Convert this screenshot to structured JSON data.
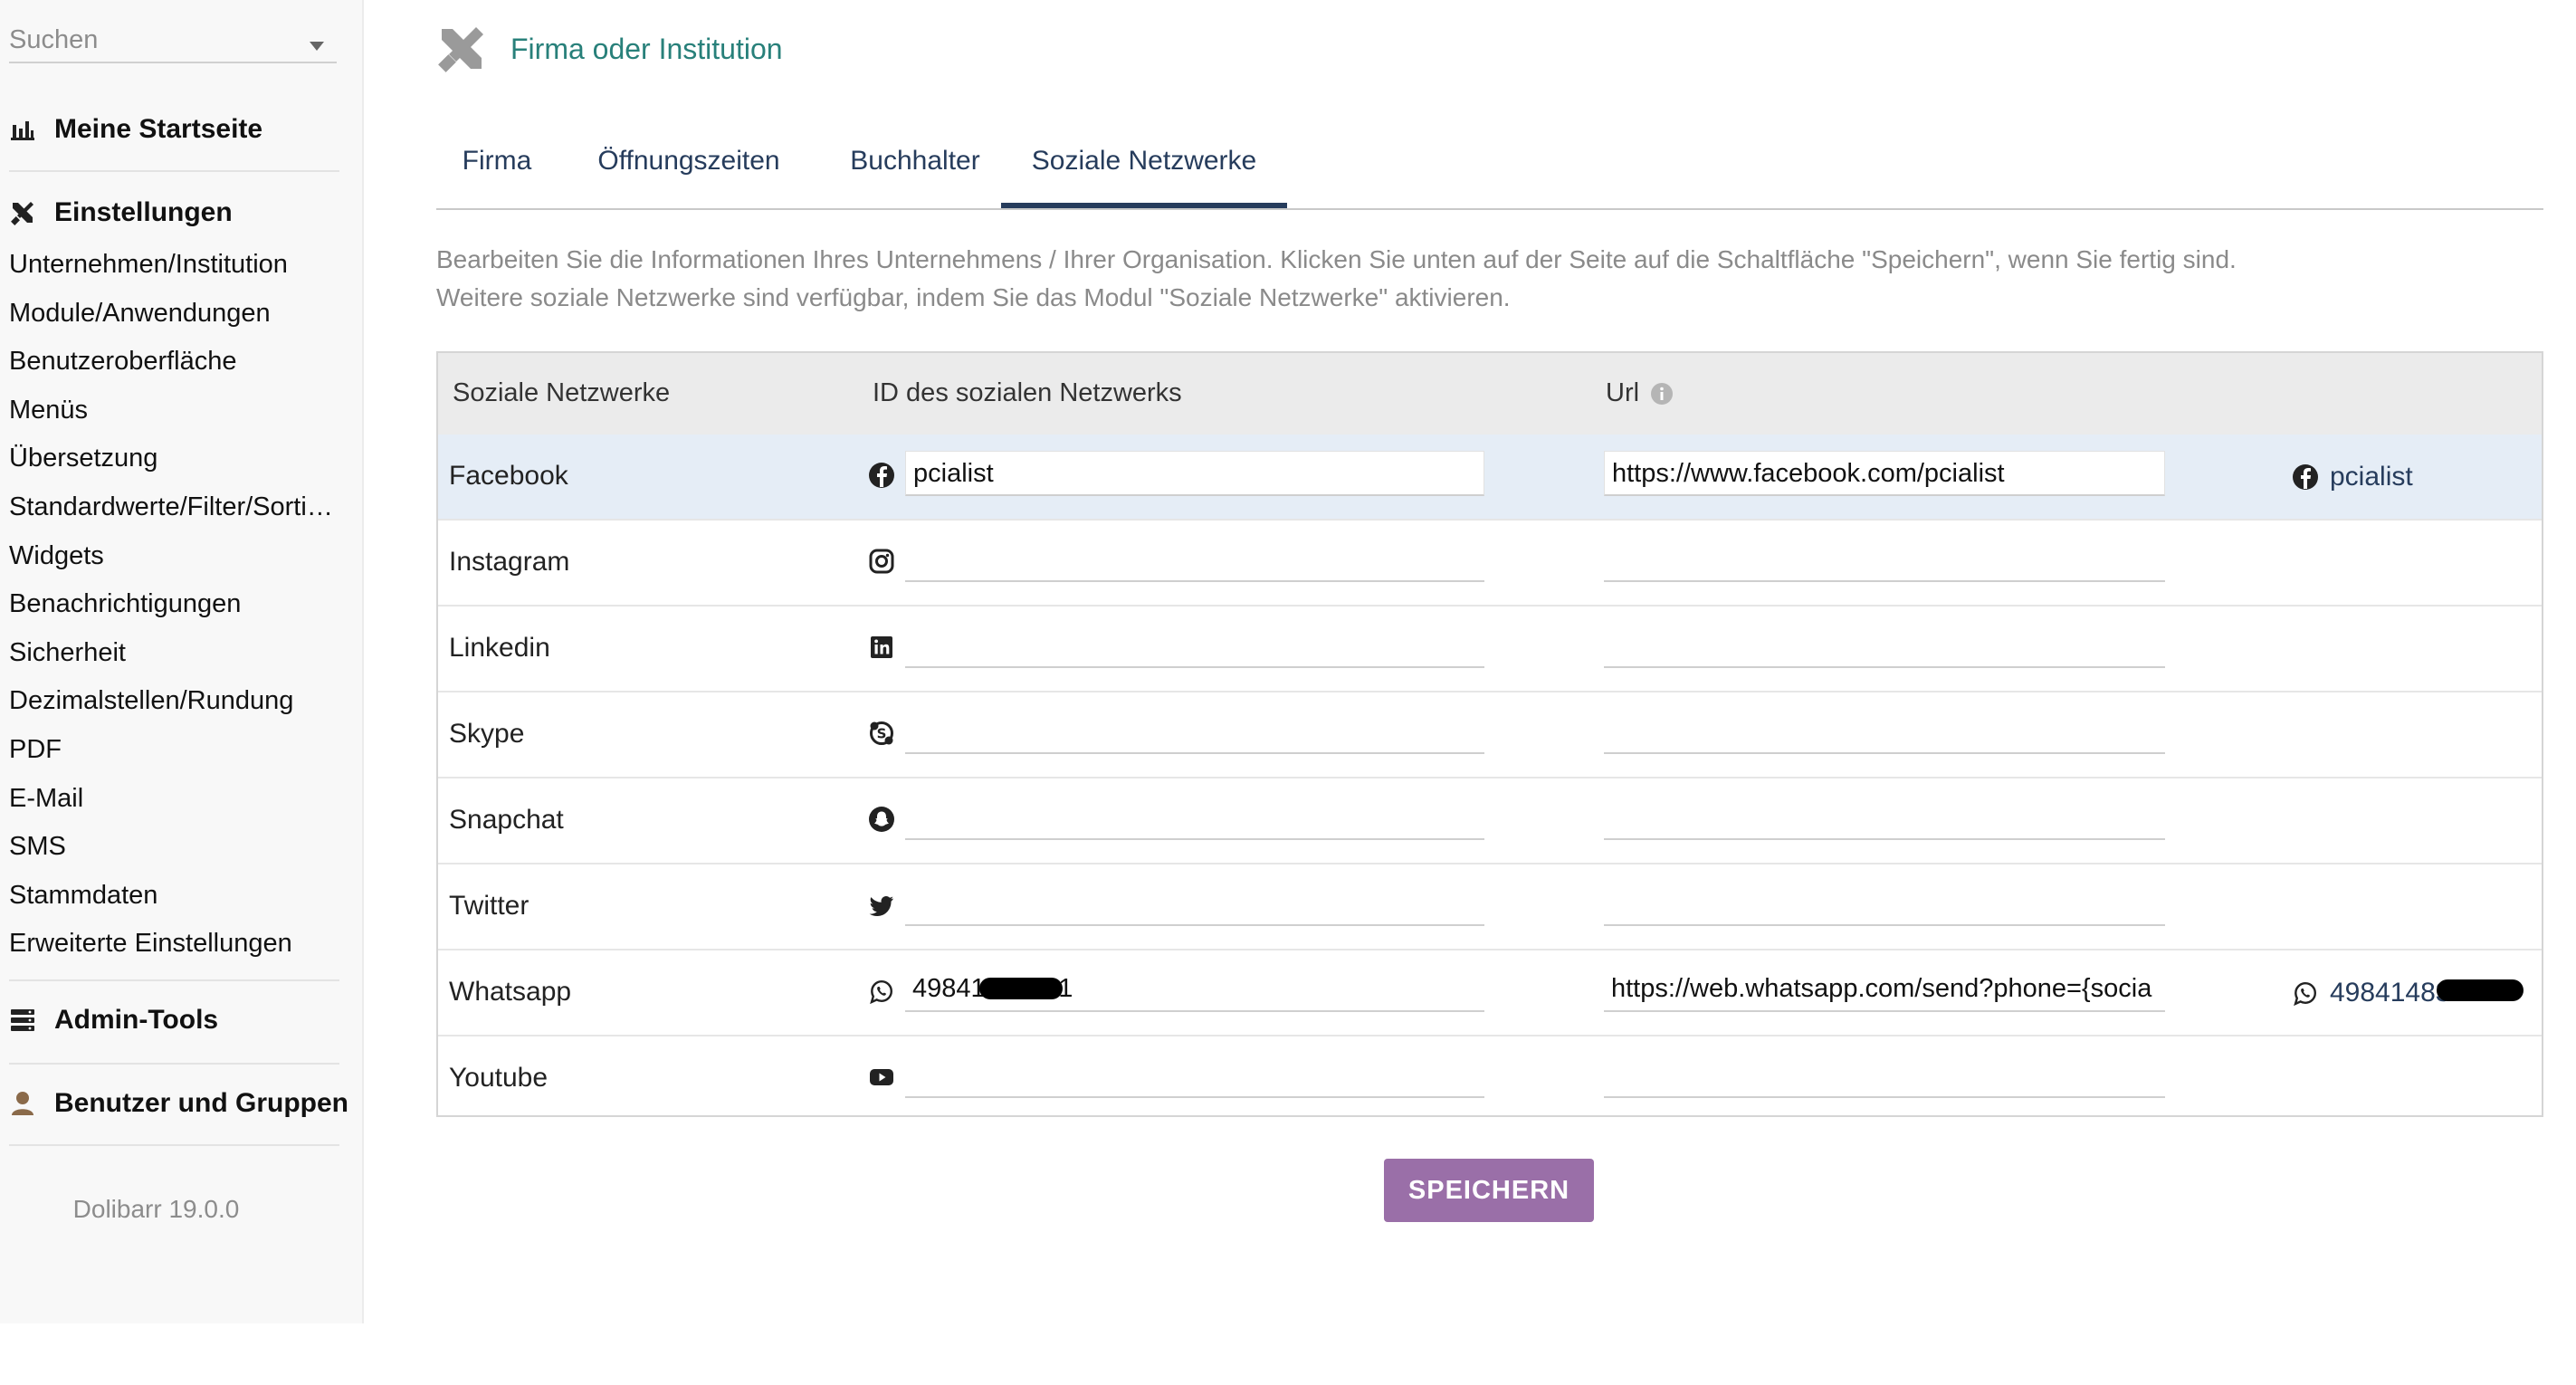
{
  "sidebar": {
    "search_placeholder": "Suchen",
    "home_label": "Meine Startseite",
    "settings_label": "Einstellungen",
    "settings_items": [
      "Unternehmen/Institution",
      "Module/Anwendungen",
      "Benutzeroberfläche",
      "Menüs",
      "Übersetzung",
      "Standardwerte/Filter/Sortierung",
      "Widgets",
      "Benachrichtigungen",
      "Sicherheit",
      "Dezimalstellen/Rundung",
      "PDF",
      "E-Mail",
      "SMS",
      "Stammdaten",
      "Erweiterte Einstellungen"
    ],
    "admin_tools_label": "Admin-Tools",
    "users_groups_label": "Benutzer und Gruppen",
    "version": "Dolibarr 19.0.0"
  },
  "header": {
    "title": "Firma oder Institution"
  },
  "tabs": [
    {
      "label": "Firma",
      "active": false
    },
    {
      "label": "Öffnungszeiten",
      "active": false
    },
    {
      "label": "Buchhalter",
      "active": false
    },
    {
      "label": "Soziale Netzwerke",
      "active": true
    }
  ],
  "description": {
    "line1": "Bearbeiten Sie die Informationen Ihres Unternehmens / Ihrer Organisation. Klicken Sie unten auf der Seite auf die Schaltfläche \"Speichern\", wenn Sie fertig sind.",
    "line2": "Weitere soziale Netzwerke sind verfügbar, indem Sie das Modul \"Soziale Netzwerke\" aktivieren."
  },
  "table": {
    "headers": {
      "network": "Soziale Netzwerke",
      "id": "ID des sozialen Netzwerks",
      "url": "Url"
    },
    "rows": [
      {
        "name": "Facebook",
        "icon": "facebook-icon",
        "id": "pcialist",
        "url": "https://www.facebook.com/pcialist",
        "preview": "pcialist"
      },
      {
        "name": "Instagram",
        "icon": "instagram-icon",
        "id": "",
        "url": "",
        "preview": ""
      },
      {
        "name": "Linkedin",
        "icon": "linkedin-icon",
        "id": "",
        "url": "",
        "preview": ""
      },
      {
        "name": "Skype",
        "icon": "skype-icon",
        "id": "",
        "url": "",
        "preview": ""
      },
      {
        "name": "Snapchat",
        "icon": "snapchat-icon",
        "id": "",
        "url": "",
        "preview": ""
      },
      {
        "name": "Twitter",
        "icon": "twitter-icon",
        "id": "",
        "url": "",
        "preview": ""
      },
      {
        "name": "Whatsapp",
        "icon": "whatsapp-icon",
        "id": "49841483421",
        "url": "https://web.whatsapp.com/send?phone={socia",
        "preview": "49841483421"
      },
      {
        "name": "Youtube",
        "icon": "youtube-icon",
        "id": "",
        "url": "",
        "preview": ""
      }
    ]
  },
  "save_label": "SPEICHERN",
  "colors": {
    "accent": "#263c5c",
    "title": "#28807a",
    "save_button": "#9a6fa8",
    "row_highlight": "#e5edf6"
  }
}
